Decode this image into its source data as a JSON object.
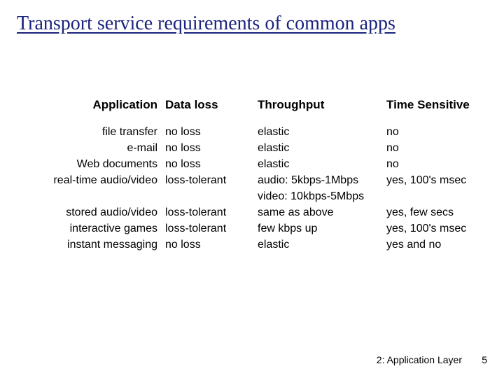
{
  "title": "Transport service requirements of common apps",
  "headers": {
    "application": "Application",
    "dataloss": "Data loss",
    "throughput": "Throughput",
    "timesensitive": "Time Sensitive"
  },
  "rows": {
    "r1": {
      "app": "file transfer",
      "loss": "no loss",
      "thru": "elastic",
      "time": "no"
    },
    "r2": {
      "app": "e-mail",
      "loss": "no loss",
      "thru": "elastic",
      "time": "no"
    },
    "r3": {
      "app": "Web documents",
      "loss": "no loss",
      "thru": "elastic",
      "time": "no"
    },
    "r4": {
      "app": "real-time audio/video",
      "loss": "loss-tolerant",
      "thru": "audio: 5kbps-1Mbps",
      "time": "yes, 100's msec"
    },
    "r4b": {
      "thru": "video: 10kbps-5Mbps"
    },
    "r5": {
      "app": "stored audio/video",
      "loss": "loss-tolerant",
      "thru": "same as above",
      "time": "yes, few secs"
    },
    "r6": {
      "app": "interactive games",
      "loss": "loss-tolerant",
      "thru": "few kbps up",
      "time": "yes, 100's msec"
    },
    "r7": {
      "app": "instant messaging",
      "loss": "no loss",
      "thru": "elastic",
      "time": "yes and no"
    }
  },
  "footer": {
    "chapter": "2: Application Layer",
    "page": "5"
  },
  "chart_data": {
    "type": "table",
    "title": "Transport service requirements of common apps",
    "columns": [
      "Application",
      "Data loss",
      "Throughput",
      "Time Sensitive"
    ],
    "rows": [
      [
        "file transfer",
        "no loss",
        "elastic",
        "no"
      ],
      [
        "e-mail",
        "no loss",
        "elastic",
        "no"
      ],
      [
        "Web documents",
        "no loss",
        "elastic",
        "no"
      ],
      [
        "real-time audio/video",
        "loss-tolerant",
        "audio: 5kbps-1Mbps; video: 10kbps-5Mbps",
        "yes, 100's msec"
      ],
      [
        "stored audio/video",
        "loss-tolerant",
        "same as above",
        "yes, few secs"
      ],
      [
        "interactive games",
        "loss-tolerant",
        "few kbps up",
        "yes, 100's msec"
      ],
      [
        "instant messaging",
        "no loss",
        "elastic",
        "yes and no"
      ]
    ]
  }
}
